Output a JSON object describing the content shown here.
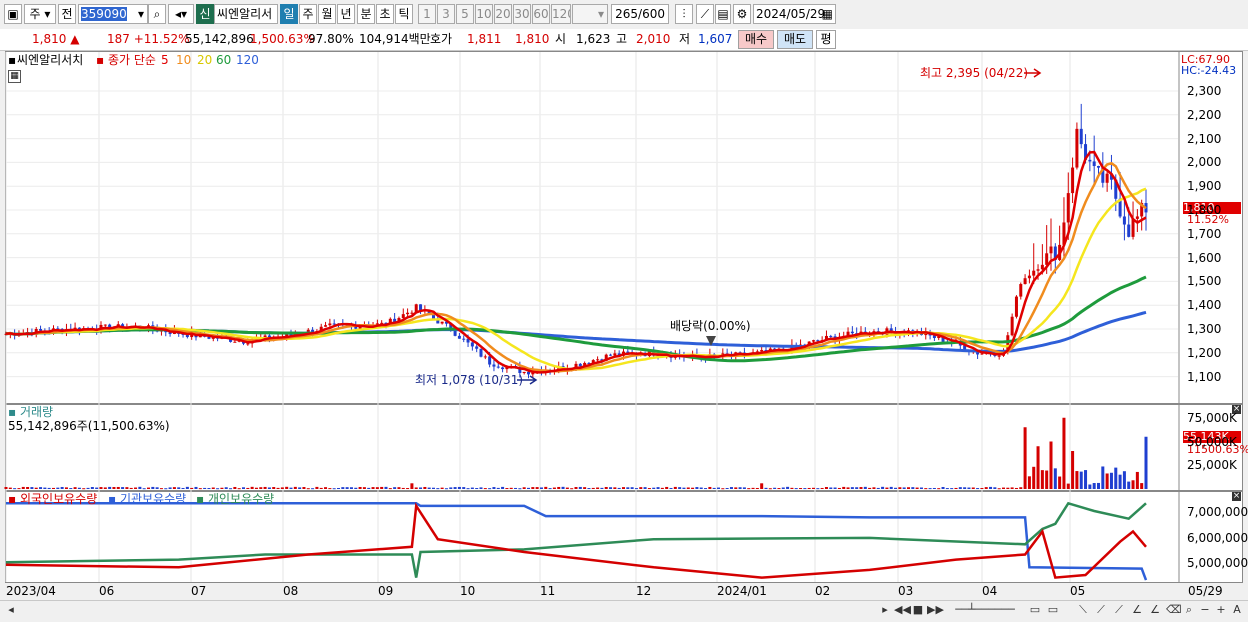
{
  "toolbar": {
    "type_label": "주",
    "prev_label": "전",
    "code": "359090",
    "new_badge": "신",
    "name": "씨엔알리서",
    "periods": [
      "일",
      "주",
      "월",
      "년",
      "분",
      "초",
      "틱"
    ],
    "active_period": "일",
    "intervals": [
      "1",
      "3",
      "5",
      "10",
      "20",
      "30",
      "60",
      "120"
    ],
    "count": "265",
    "count_total": "/600",
    "date": "2024/05/29"
  },
  "quote": {
    "price": "1,810",
    "arrow": "▲",
    "change": "187",
    "change_pct": "+11.52%",
    "volume": "55,142,896",
    "volume_pct": "1,500.63%",
    "ratio": "97.80%",
    "amount": "104,914백만",
    "bid_label": "호가",
    "bid1": "1,811",
    "bid2": "1,810",
    "open_label": "시",
    "open": "1,623",
    "high_label": "고",
    "high": "2,010",
    "low_label": "저",
    "low": "1,607",
    "buy_label": "매수",
    "sell_label": "매도",
    "eval_label": "평"
  },
  "price_panel": {
    "name_tab": "씨엔알리서치",
    "ma_title": "종가 단순",
    "ma_periods": [
      "5",
      "10",
      "20",
      "60",
      "120"
    ],
    "lc": "LC:67.90",
    "hc": "HC:-24.43",
    "y_ticks": [
      "2,300",
      "2,200",
      "2,100",
      "2,000",
      "1,900",
      "1,800",
      "1,700",
      "1,600",
      "1,500",
      "1,400",
      "1,300",
      "1,200",
      "1,100"
    ],
    "current_price": "1,810",
    "current_pct": "11.52%",
    "high_annotation": "최고 2,395 (04/22)",
    "low_annotation": "최저 1,078 (10/31)",
    "dividend_annotation": "배당락(0.00%)"
  },
  "volume_panel": {
    "title": "거래량",
    "info": "55,142,896주(11,500.63%)",
    "y_ticks": [
      "75,000K",
      "50,000K",
      "25,000K"
    ],
    "current": "55,143K",
    "current_pct": "11500.63%"
  },
  "holders_panel": {
    "legends": [
      "외국인보유수량",
      "기관보유수량",
      "개인보유수량"
    ],
    "y_ticks": [
      "7,000,000",
      "6,000,000",
      "5,000,000"
    ]
  },
  "x_axis": [
    "2023/04",
    "06",
    "07",
    "08",
    "09",
    "10",
    "11",
    "12",
    "2024/01",
    "02",
    "03",
    "04",
    "05",
    "05/29"
  ],
  "colors": {
    "up": "#d40000",
    "down": "#1f3fd0",
    "ma5": "#e00000",
    "ma10": "#f08c1e",
    "ma20": "#f5e61e",
    "ma60": "#1e9b3c",
    "ma120": "#2e5fd8",
    "foreign": "#d40000",
    "institution": "#2e5fd8",
    "individual": "#2e8b57"
  }
}
